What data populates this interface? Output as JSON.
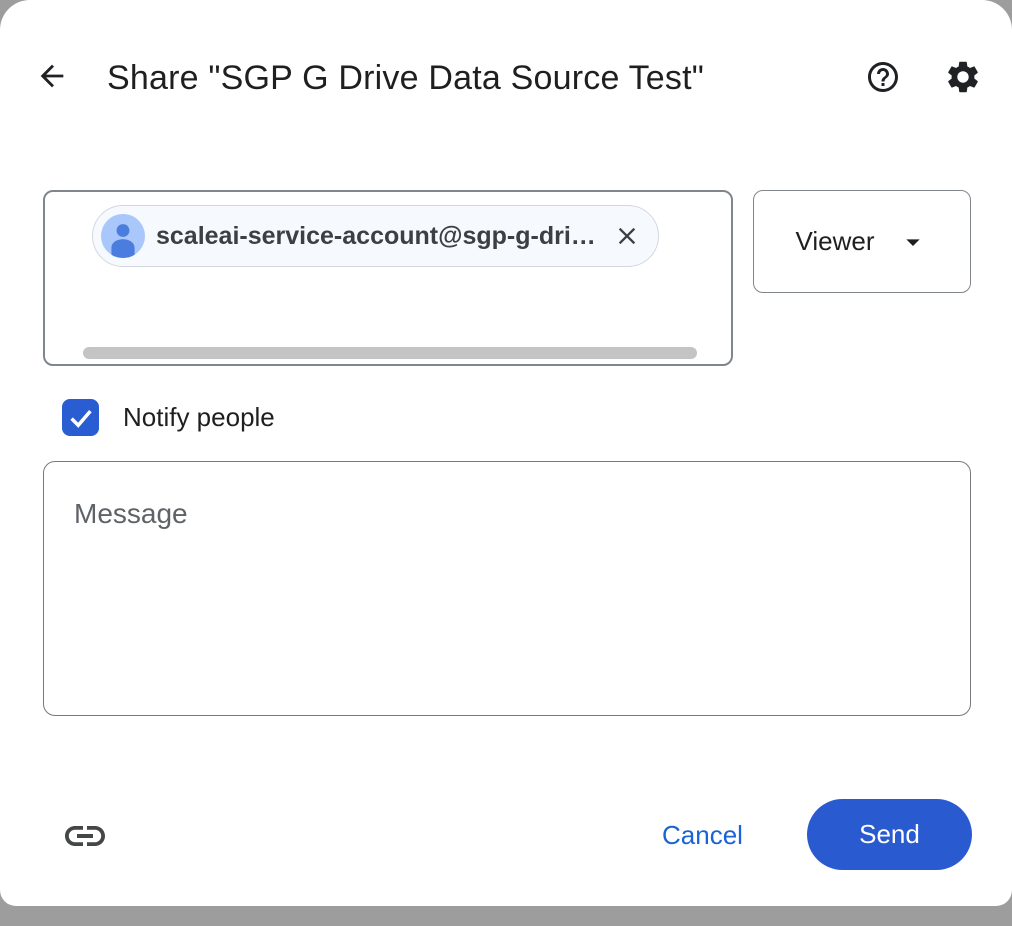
{
  "header": {
    "title": "Share \"SGP G Drive Data Source Test\"",
    "icons": {
      "back": "arrow-left",
      "help": "question-mark-circle",
      "settings": "gear"
    }
  },
  "recipients": {
    "chip": {
      "email": "scaleai-service-account@sgp-g-dri…",
      "avatar_icon": "person-icon",
      "remove_icon": "close-x"
    },
    "scrollbar": "horizontal-thumb"
  },
  "role_selector": {
    "value": "Viewer",
    "dropdown_icon": "triangle-down"
  },
  "notify": {
    "label": "Notify people",
    "checked": true
  },
  "message": {
    "placeholder": "Message",
    "value": ""
  },
  "footer": {
    "copy_link_icon": "link-chain",
    "cancel_label": "Cancel",
    "send_label": "Send"
  },
  "colors": {
    "accent_blue": "#2a5ad0",
    "checkbox_blue": "#2a5dd2",
    "cancel_text_blue": "#1a63d6",
    "avatar_bg": "#a9c7fa",
    "avatar_person": "#4a7ddd",
    "chip_bg": "#f6f9fe",
    "border_gray": "#80868b",
    "scrollbar_gray": "#c4c4c4",
    "backdrop_gray": "#9d9d9d",
    "text_dark": "#1f1f1f"
  }
}
